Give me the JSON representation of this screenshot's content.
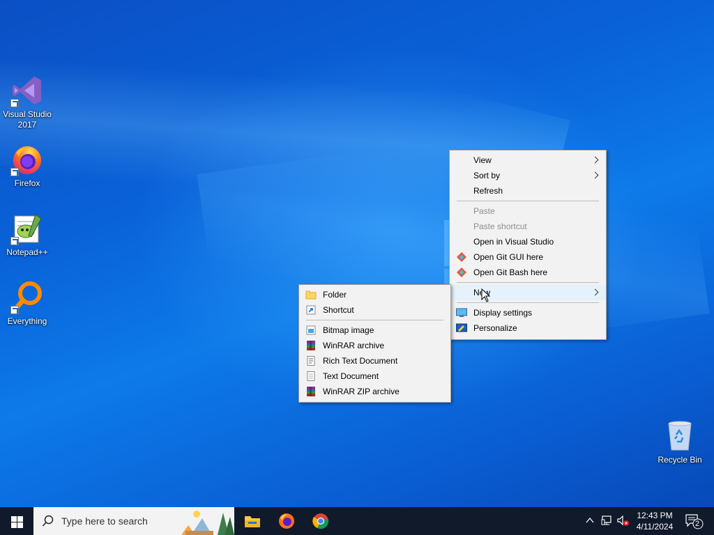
{
  "desktop": {
    "icons": [
      {
        "label": "Visual Studio 2017",
        "icon": "visual-studio-icon"
      },
      {
        "label": "Firefox",
        "icon": "firefox-icon"
      },
      {
        "label": "Notepad++",
        "icon": "notepadpp-icon"
      },
      {
        "label": "Everything",
        "icon": "everything-search-icon"
      },
      {
        "label": "Recycle Bin",
        "icon": "recycle-bin-icon"
      }
    ]
  },
  "context_menu": {
    "items": [
      {
        "label": "View",
        "submenu": true
      },
      {
        "label": "Sort by",
        "submenu": true
      },
      {
        "label": "Refresh"
      },
      {
        "label": "Paste",
        "disabled": true
      },
      {
        "label": "Paste shortcut",
        "disabled": true
      },
      {
        "label": "Open in Visual Studio"
      },
      {
        "label": "Open Git GUI here",
        "icon": "git-icon"
      },
      {
        "label": "Open Git Bash here",
        "icon": "git-icon"
      },
      {
        "label": "New",
        "submenu": true,
        "highlighted": true
      },
      {
        "label": "Display settings",
        "icon": "display-icon"
      },
      {
        "label": "Personalize",
        "icon": "personalize-icon"
      }
    ]
  },
  "new_submenu": {
    "items": [
      {
        "label": "Folder",
        "icon": "folder-icon"
      },
      {
        "label": "Shortcut",
        "icon": "shortcut-icon"
      },
      {
        "label": "Bitmap image",
        "icon": "bitmap-icon"
      },
      {
        "label": "WinRAR archive",
        "icon": "winrar-icon"
      },
      {
        "label": "Rich Text Document",
        "icon": "rtf-document-icon"
      },
      {
        "label": "Text Document",
        "icon": "text-document-icon"
      },
      {
        "label": "WinRAR ZIP archive",
        "icon": "winrar-zip-icon"
      }
    ]
  },
  "taskbar": {
    "search_placeholder": "Type here to search",
    "pinned": [
      "file-explorer-icon",
      "firefox-icon",
      "chrome-icon"
    ],
    "clock_time": "12:43 PM",
    "clock_date": "4/11/2024",
    "notification_count": "2"
  },
  "colors": {
    "menu_bg": "#f2f2f2",
    "taskbar_bg": "#101a2b",
    "highlight": "#e5f1fb"
  }
}
